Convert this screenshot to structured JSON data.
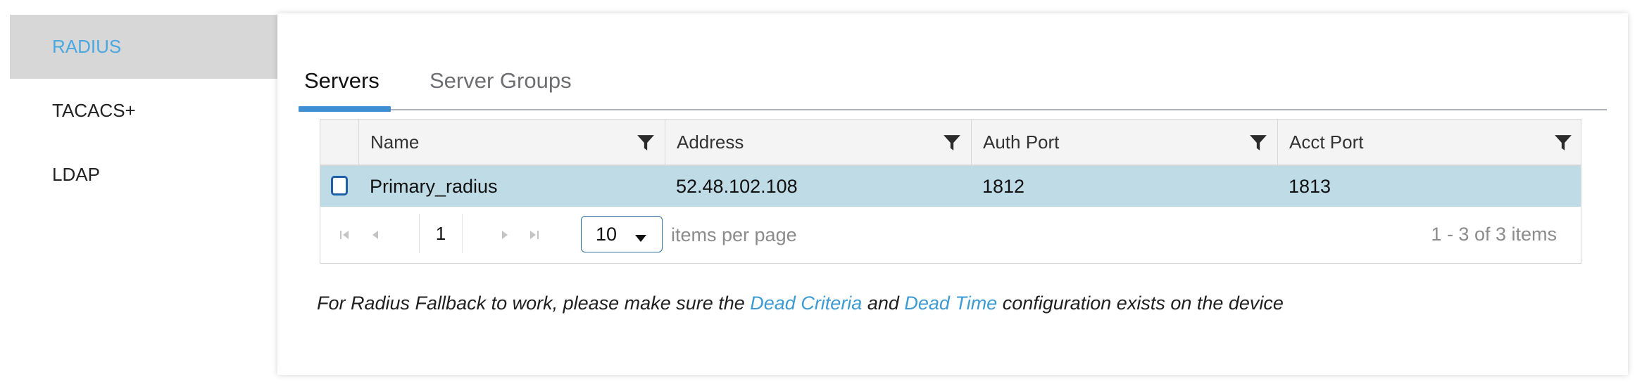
{
  "sidebar": {
    "items": [
      {
        "label": "RADIUS",
        "active": true
      },
      {
        "label": "TACACS+",
        "active": false
      },
      {
        "label": "LDAP",
        "active": false
      }
    ]
  },
  "tabs": [
    {
      "label": "Servers",
      "active": true
    },
    {
      "label": "Server Groups",
      "active": false
    }
  ],
  "grid": {
    "columns": [
      "Name",
      "Address",
      "Auth Port",
      "Acct Port"
    ],
    "rows": [
      {
        "name": "Primary_radius",
        "address": "52.48.102.108",
        "auth_port": "1812",
        "acct_port": "1813",
        "selected": false
      }
    ],
    "pager": {
      "current_page": "1",
      "page_size": "10",
      "page_size_label": "items per page",
      "summary": "1 - 3 of 3 items"
    }
  },
  "note": {
    "prefix": "For Radius Fallback to work, please make sure the ",
    "link1": "Dead Criteria",
    "middle": " and ",
    "link2": "Dead Time",
    "suffix": " configuration exists on the device"
  },
  "colors": {
    "accent": "#3e8fd3",
    "active_nav_text": "#4aa8e0",
    "active_nav_bg": "#d8d7d8",
    "selected_row": "#bfdbe6",
    "link": "#3c9bd3"
  },
  "icons": {
    "filter": "funnel-icon",
    "first_page": "first-page-icon",
    "prev_page": "prev-page-icon",
    "next_page": "next-page-icon",
    "last_page": "last-page-icon"
  }
}
